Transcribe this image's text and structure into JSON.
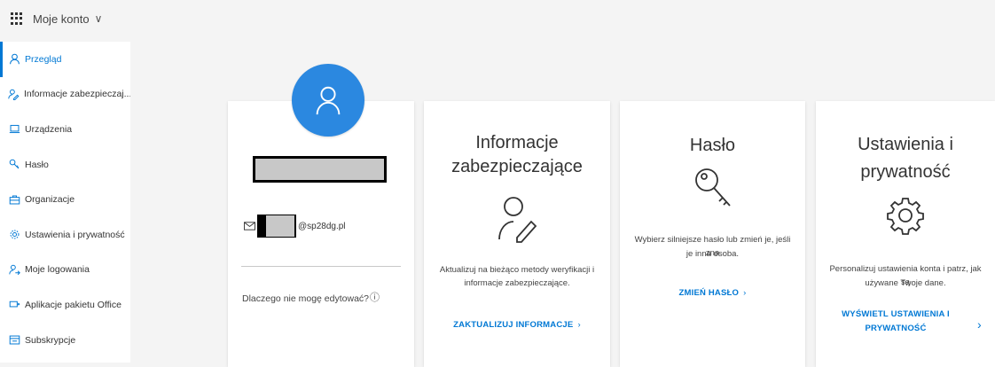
{
  "header": {
    "app_title": "Moje konto",
    "app_chevron": "∨"
  },
  "sidebar": {
    "items": [
      {
        "label": "Przegląd",
        "icon": "person-icon",
        "active": true
      },
      {
        "label": "Informacje zabezpieczaj...",
        "icon": "security-info-icon",
        "active": false
      },
      {
        "label": "Urządzenia",
        "icon": "laptop-icon",
        "active": false
      },
      {
        "label": "Hasło",
        "icon": "key-icon",
        "active": false
      },
      {
        "label": "Organizacje",
        "icon": "briefcase-icon",
        "active": false
      },
      {
        "label": "Ustawienia i prywatność",
        "icon": "gear-icon",
        "active": false
      },
      {
        "label": "Moje logowania",
        "icon": "sign-ins-icon",
        "active": false
      },
      {
        "label": "Aplikacje pakietu Office",
        "icon": "office-apps-icon",
        "active": false
      },
      {
        "label": "Subskrypcje",
        "icon": "subscriptions-icon",
        "active": false
      }
    ]
  },
  "profile": {
    "email_suffix": "@sp28dg.pl",
    "why_cant_edit": "Dlaczego nie mogę edytować?",
    "info_glyph": "ⓘ"
  },
  "cards": {
    "security_info": {
      "title_line1": "Informacje",
      "title_line2": "zabezpieczające",
      "desc_line1": "Aktualizuj na bieżąco metody weryfikacji i",
      "desc_line2": "informacje zabezpieczające.",
      "link": "ZAKTUALIZUJ INFORMACJE",
      "link_chevron": "›"
    },
    "password": {
      "title": "Hasło",
      "desc_line1": "Wybierz silniejsze hasło lub zmień je, jeśli zna",
      "desc_line2": "je inna osoba.",
      "link": "ZMIEŃ HASŁO",
      "link_chevron": "›"
    },
    "settings": {
      "title_line1": "Ustawienia i",
      "title_line2": "prywatność",
      "desc_line1": "Personalizuj ustawienia konta i patrz, jak są",
      "desc_line2": "używane Twoje dane.",
      "link_line1": "WYŚWIETL USTAWIENIA I",
      "link_line2": "PRYWATNOŚĆ",
      "link_chevron": "›"
    }
  },
  "colors": {
    "accent": "#0078d4",
    "avatar": "#2b88e0",
    "background": "#f4f4f4"
  }
}
